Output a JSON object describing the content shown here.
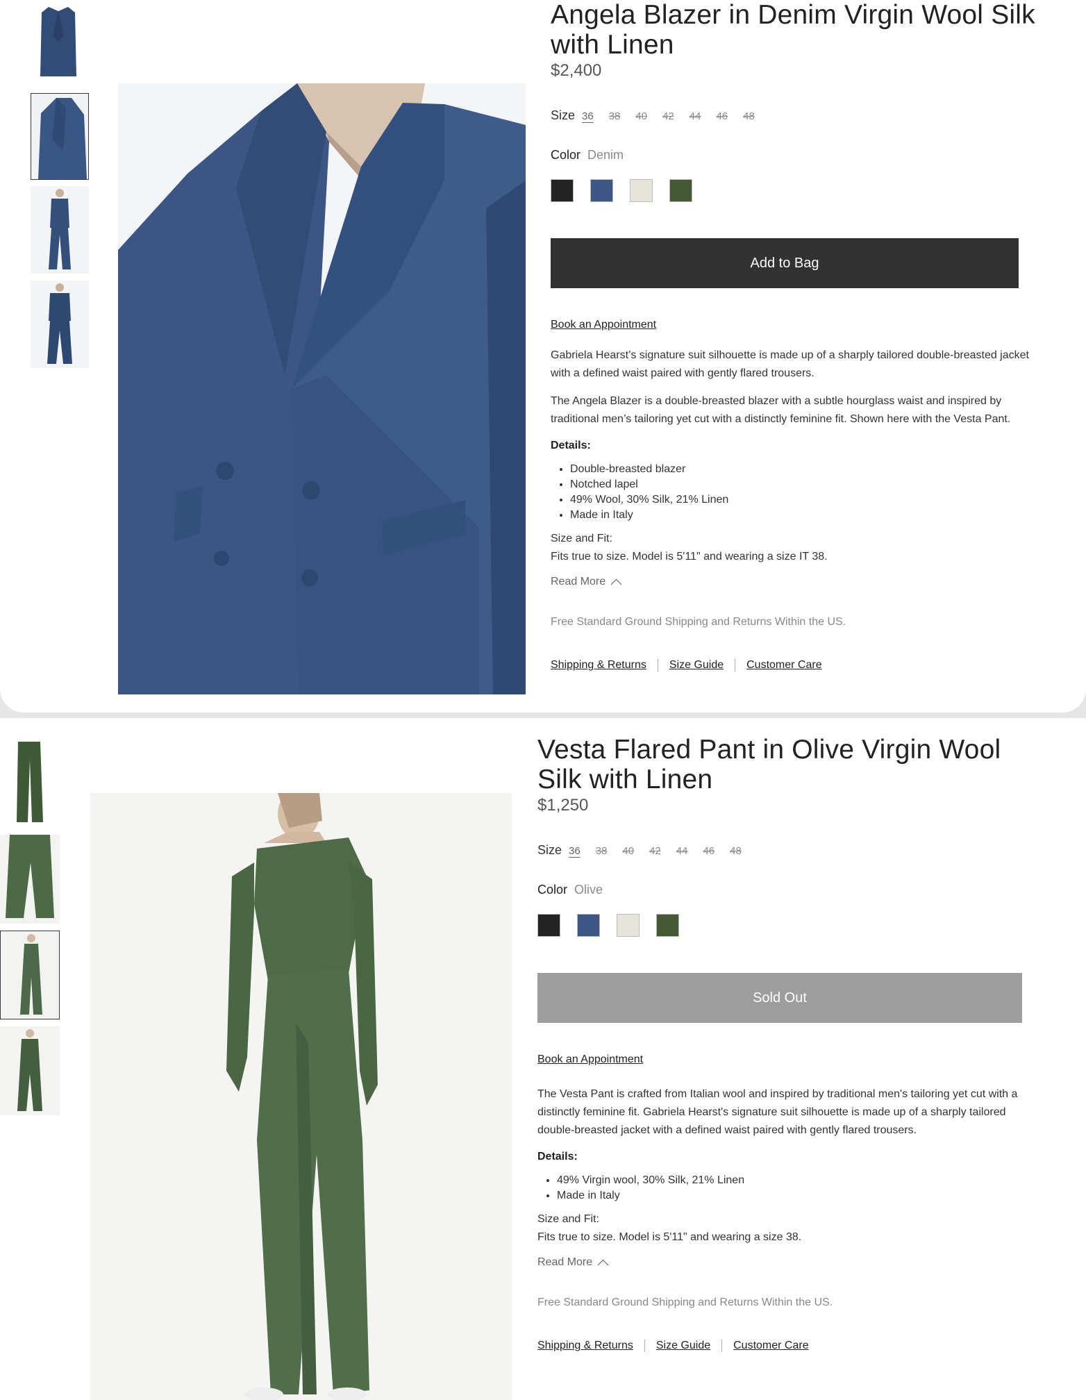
{
  "products": [
    {
      "title": "Angela Blazer in Denim Virgin Wool Silk with Linen",
      "price": "$2,400",
      "size_label": "Size",
      "sizes": [
        "36",
        "38",
        "40",
        "42",
        "44",
        "46",
        "48"
      ],
      "selected_size": "36",
      "color_label": "Color",
      "color_value": "Denim",
      "swatch_colors": [
        "#232323",
        "#3d5685",
        "#e7e4dc",
        "#445a35"
      ],
      "button_label": "Add to Bag",
      "appointment_label": "Book an Appointment",
      "description": [
        "Gabriela Hearst’s signature suit silhouette is made up of a sharply tailored double-breasted jacket with a defined waist paired with gently flared trousers.",
        "The Angela Blazer is a double-breasted blazer with a subtle hourglass waist and inspired by traditional men’s tailoring yet cut with a distinctly feminine fit. Shown here with the Vesta Pant."
      ],
      "details_heading": "Details:",
      "details": [
        "Double-breasted blazer",
        "Notched lapel",
        "49% Wool, 30% Silk, 21% Linen",
        "Made in Italy"
      ],
      "size_fit_heading": "Size and Fit:",
      "size_fit_text": "Fits true to size. Model is 5'11\" and wearing a size IT 38.",
      "read_more": "Read More",
      "shipping_note": "Free Standard Ground Shipping and Returns Within the US.",
      "footer_links": [
        "Shipping & Returns",
        "Size Guide",
        "Customer Care"
      ]
    },
    {
      "title": "Vesta Flared Pant in Olive Virgin Wool Silk with Linen",
      "price": "$1,250",
      "size_label": "Size",
      "sizes": [
        "36",
        "38",
        "40",
        "42",
        "44",
        "46",
        "48"
      ],
      "selected_size": "36",
      "color_label": "Color",
      "color_value": "Olive",
      "swatch_colors": [
        "#232323",
        "#3d5685",
        "#e7e4dc",
        "#445a35"
      ],
      "button_label": "Sold Out",
      "appointment_label": "Book an Appointment",
      "description": [
        "The Vesta Pant is crafted from Italian wool and inspired by traditional men's tailoring yet cut with a distinctly feminine fit. Gabriela Hearst's signature suit silhouette is made up of a sharply tailored double-breasted jacket with a defined waist paired with gently flared trousers."
      ],
      "details_heading": "Details:",
      "details": [
        "49% Virgin wool, 30% Silk, 21% Linen",
        "Made in Italy"
      ],
      "size_fit_heading": "Size and Fit:",
      "size_fit_text": "Fits true to size. Model is 5'11\" and wearing a size 38.",
      "read_more": "Read More",
      "shipping_note": "Free Standard Ground Shipping and Returns Within the US.",
      "footer_links": [
        "Shipping & Returns",
        "Size Guide",
        "Customer Care"
      ]
    }
  ]
}
